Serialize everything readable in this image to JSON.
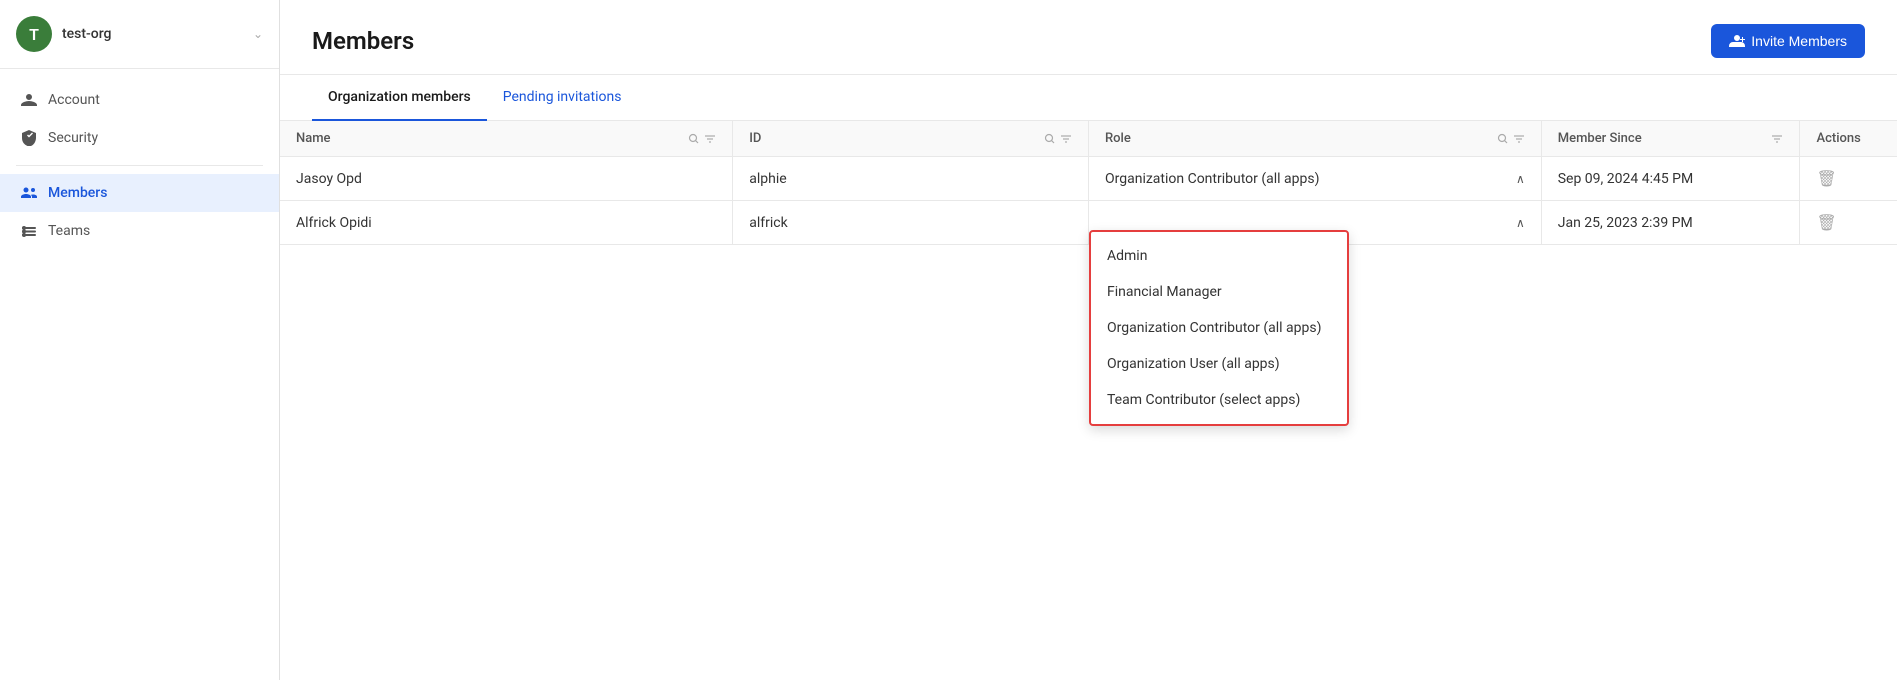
{
  "sidebar": {
    "org_avatar_letter": "T",
    "org_name": "test-org",
    "items": [
      {
        "id": "account",
        "label": "Account",
        "icon": "person"
      },
      {
        "id": "security",
        "label": "Security",
        "icon": "shield"
      },
      {
        "id": "members",
        "label": "Members",
        "icon": "members",
        "active": true
      },
      {
        "id": "teams",
        "label": "Teams",
        "icon": "teams"
      }
    ]
  },
  "header": {
    "title": "Members",
    "invite_button_label": "Invite Members"
  },
  "tabs": [
    {
      "id": "org-members",
      "label": "Organization members",
      "active": true
    },
    {
      "id": "pending",
      "label": "Pending invitations",
      "active": false
    }
  ],
  "table": {
    "columns": [
      "Name",
      "ID",
      "Role",
      "Member Since",
      "Actions"
    ],
    "rows": [
      {
        "name": "Jasoy Opd",
        "id": "alphie",
        "role": "Organization Contributor (all apps)",
        "member_since": "Sep 09, 2024 4:45 PM",
        "dropdown_open": false
      },
      {
        "name": "Alfrick Opidi",
        "id": "alfrick",
        "role": "",
        "member_since": "Jan 25, 2023 2:39 PM",
        "dropdown_open": true
      }
    ]
  },
  "dropdown": {
    "options": [
      "Admin",
      "Financial Manager",
      "Organization Contributor (all apps)",
      "Organization User (all apps)",
      "Team Contributor (select apps)"
    ]
  }
}
